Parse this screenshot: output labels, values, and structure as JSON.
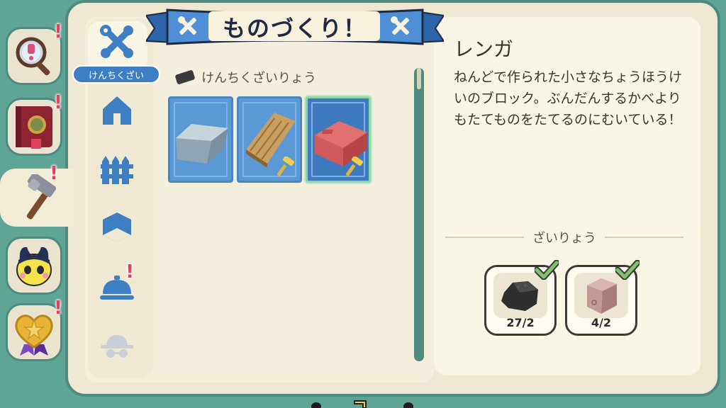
{
  "title": "ものづくり！",
  "category_label": "けんちくざい",
  "section_title": "けんちくざいりょう",
  "item": {
    "name": "レンガ",
    "description": "ねんどで作られた小さなちょうほうけいのブロック。ぶんだんするかべよりもたてものをたてるのにむいている！"
  },
  "materials_heading": "ざいりょう",
  "materials": [
    {
      "name": "coal",
      "count": "27/2"
    },
    {
      "name": "clay",
      "count": "4/2"
    }
  ],
  "colors": {
    "accent_blue": "#3e7fc4",
    "teal": "#4f8a80",
    "alert": "#e8405a",
    "check_green": "#7cc46a"
  },
  "side_tabs": [
    {
      "icon": "magnifier-icon",
      "alert": "!"
    },
    {
      "icon": "book-icon",
      "alert": "!"
    },
    {
      "icon": "hammer-icon",
      "alert": "!"
    },
    {
      "icon": "character-icon",
      "alert": ""
    },
    {
      "icon": "heart-medal-icon",
      "alert": "!"
    }
  ],
  "category_alert": "!",
  "items": [
    {
      "icon": "stone-block-icon",
      "craftable": false
    },
    {
      "icon": "wood-plank-icon",
      "craftable": true
    },
    {
      "icon": "brick-icon",
      "craftable": true,
      "selected": true
    }
  ]
}
